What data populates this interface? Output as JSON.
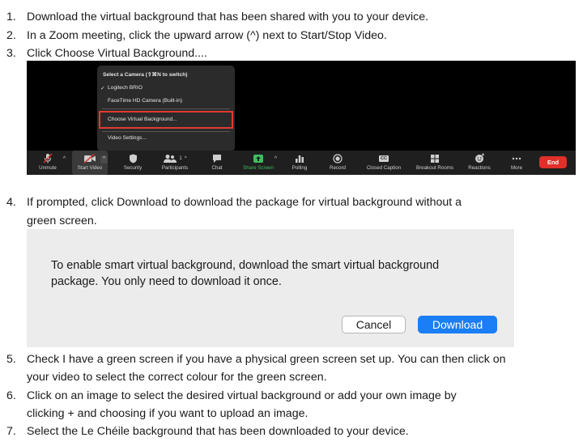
{
  "steps": [
    {
      "num": "1.",
      "lines": [
        "Download the virtual background that has been shared with you to your device."
      ]
    },
    {
      "num": "2.",
      "lines": [
        "In a Zoom meeting, click the upward arrow (^) next to Start/Stop Video."
      ]
    },
    {
      "num": "3.",
      "lines": [
        "Click Choose Virtual Background...."
      ]
    },
    {
      "num": "4.",
      "lines": [
        "If prompted, click Download to download the package for virtual background without a",
        "green screen."
      ]
    },
    {
      "num": "5.",
      "lines": [
        "Check I have a green screen if you have a physical green screen set up. You can then click on",
        "your video to select the correct colour for the green screen."
      ]
    },
    {
      "num": "6.",
      "lines": [
        "Click on an image to select the desired virtual background or add your own image by",
        "clicking + and choosing if you want to upload an image."
      ]
    },
    {
      "num": "7.",
      "lines": [
        "Select the Le Chéile background that has been downloaded to your device."
      ]
    }
  ],
  "zoom_menu": {
    "header": "Select a Camera (⇧⌘N to switch)",
    "checkmark": "✓",
    "cameras": [
      "Logitech BRIO",
      "FaceTime HD Camera (Built-in)"
    ],
    "choose_virtual_background": "Choose Virtual Background...",
    "video_settings": "Video Settings..."
  },
  "toolbar": {
    "unmute": "Unmute",
    "start_video": "Start Video",
    "security": "Security",
    "participants": "Participants",
    "participants_count": "1",
    "chat": "Chat",
    "share_screen": "Share Screen",
    "polling": "Polling",
    "record": "Record",
    "closed_caption": "Closed Caption",
    "closed_caption_icon_text": "CC",
    "breakout_rooms": "Breakout Rooms",
    "reactions": "Reactions",
    "more": "More",
    "end": "End",
    "caret": "^",
    "accent_green": "#3fbf5f",
    "end_color": "#e0302b"
  },
  "dialog": {
    "message_lines": [
      "To enable smart virtual background, download the smart virtual background",
      "package. You only need to download it once."
    ],
    "cancel": "Cancel",
    "download": "Download",
    "download_color": "#1a7ef5"
  }
}
